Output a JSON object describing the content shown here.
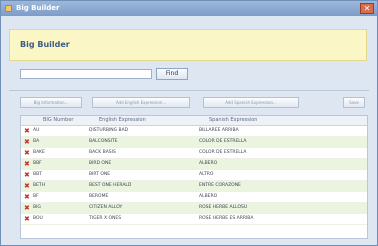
{
  "window": {
    "title": "Big Builder",
    "close_label": "✕"
  },
  "header": {
    "title": "Big Builder"
  },
  "search": {
    "value": "",
    "placeholder": "",
    "button_label": "Find"
  },
  "toolbar": {
    "buttons": [
      "Big Information...",
      "Add English Expression...",
      "Add Spanish Expression...",
      "Save"
    ]
  },
  "grid": {
    "columns": [
      "BIG Number",
      "English Expression",
      "Spanish Expression"
    ],
    "rows": [
      [
        "AU",
        "DISTURBING BAD",
        "BILLAREE ARRIBA"
      ],
      [
        "BA",
        "BALCONSITE",
        "COLOR DE ESTRELLA"
      ],
      [
        "BAKE",
        "BACK BASIS",
        "COLOR DE ESTRELLA"
      ],
      [
        "BBF",
        "BIRD ONE",
        "ALBERO"
      ],
      [
        "BBT",
        "BIRT ONE",
        "ALTRO"
      ],
      [
        "BETH",
        "BEST ONE HERALD",
        "ENTRE CORAZONE"
      ],
      [
        "BF",
        "BEROME",
        "ALBERO"
      ],
      [
        "BIG",
        "CITIZEN ALLOY",
        "ROSE HERBE ALLOSU"
      ],
      [
        "BOU",
        "TIGER X ONES",
        "ROSE HERBE ES ARRIBA"
      ]
    ]
  },
  "colors": {
    "title_bar": "#7c9cc8",
    "header_bg": "#fbf6c6",
    "row_alt": "#eaf4df",
    "delete_icon": "#c2332a"
  }
}
